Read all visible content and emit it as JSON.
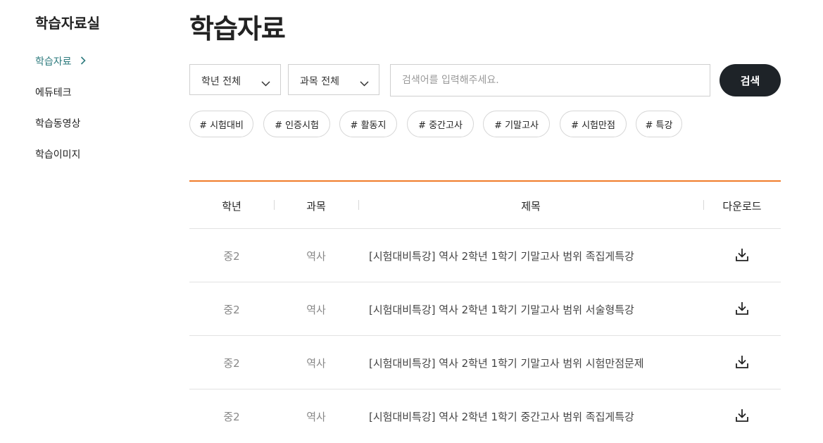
{
  "sidebar": {
    "title": "학습자료실",
    "items": [
      {
        "label": "학습자료",
        "active": true
      },
      {
        "label": "에듀테크",
        "active": false
      },
      {
        "label": "학습동영상",
        "active": false
      },
      {
        "label": "학습이미지",
        "active": false
      }
    ]
  },
  "main": {
    "title": "학습자료",
    "filters": {
      "grade_select": "학년 전체",
      "subject_select": "과목 전체",
      "search_placeholder": "검색어를 입력해주세요.",
      "search_button": "검색"
    },
    "tags": [
      "# 시험대비",
      "#  인증시험",
      "#  활동지",
      "#  중간고사",
      "#  기말고사",
      "#  시험만점",
      "# 특강"
    ],
    "table": {
      "headers": [
        "학년",
        "과목",
        "제목",
        "다운로드"
      ],
      "rows": [
        {
          "grade": "중2",
          "subject": "역사",
          "title": "[시험대비특강] 역사 2학년 1학기 기말고사 범위 족집게특강"
        },
        {
          "grade": "중2",
          "subject": "역사",
          "title": "[시험대비특강] 역사 2학년 1학기 기말고사 범위 서술형특강"
        },
        {
          "grade": "중2",
          "subject": "역사",
          "title": "[시험대비특강] 역사 2학년 1학기 기말고사 범위 시험만점문제"
        },
        {
          "grade": "중2",
          "subject": "역사",
          "title": "[시험대비특강] 역사 2학년 1학기 중간고사 범위 족집게특강"
        }
      ]
    }
  },
  "colors": {
    "accent_teal": "#2e7b7e",
    "table_top_border": "#f07c2a",
    "search_button_bg": "#1e2328"
  },
  "icons": {
    "chevron": "chevron-right-icon",
    "caret": "chevron-down-icon",
    "download": "download-icon"
  }
}
